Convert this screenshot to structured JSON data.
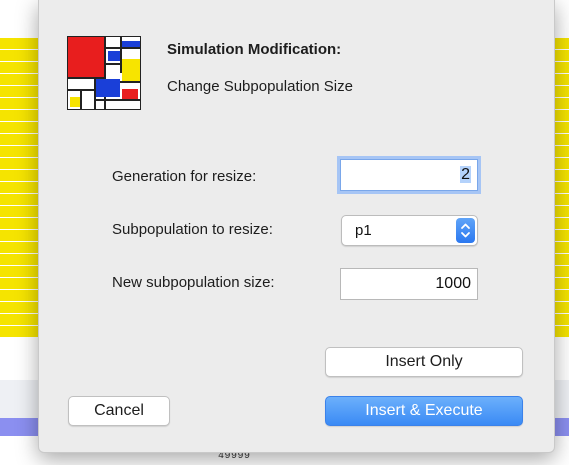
{
  "background": {
    "footer_text": "49999"
  },
  "dialog": {
    "title": "Simulation Modification:",
    "subtitle": "Change Subpopulation Size",
    "logo_icon": "mondrian-logo-icon",
    "fields": {
      "generation": {
        "label": "Generation for resize:",
        "value": "2"
      },
      "subpopulation": {
        "label": "Subpopulation to resize:",
        "value": "p1"
      },
      "size": {
        "label": "New subpopulation size:",
        "value": "1000"
      }
    },
    "buttons": {
      "insert_only": "Insert Only",
      "cancel": "Cancel",
      "insert_execute": "Insert & Execute"
    },
    "colors": {
      "accent": "#3a8af5",
      "mondrian_red": "#e81e1e",
      "mondrian_blue": "#1a3fd8",
      "mondrian_yellow": "#f7e400"
    }
  }
}
